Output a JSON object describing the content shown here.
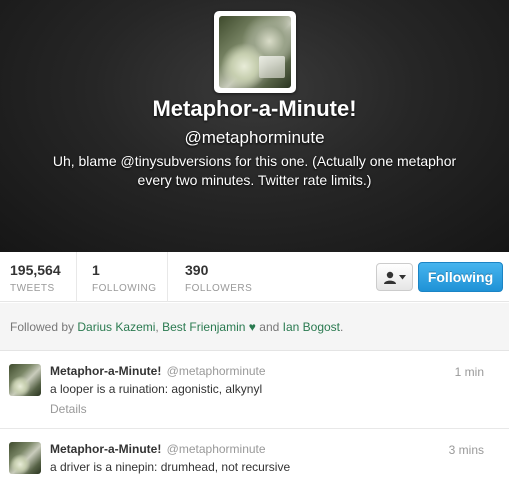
{
  "profile": {
    "name": "Metaphor-a-Minute!",
    "handle": "@metaphorminute",
    "bio": "Uh, blame @tinysubversions for this one. (Actually one metaphor every two minutes. Twitter rate limits.)"
  },
  "stats": {
    "tweets": {
      "value": "195,564",
      "label": "TWEETS"
    },
    "following": {
      "value": "1",
      "label": "FOLLOWING"
    },
    "followers": {
      "value": "390",
      "label": "FOLLOWERS"
    }
  },
  "actions": {
    "user_menu_icon": "person-icon",
    "following_label": "Following"
  },
  "followed_by": {
    "prefix": "Followed by",
    "user1": "Darius Kazemi",
    "user2": "Best Frienjamin",
    "heart": "♥",
    "conjunction": "and",
    "user3": "Ian Bogost",
    "suffix": "."
  },
  "tweets": [
    {
      "name": "Metaphor-a-Minute!",
      "handle": "@metaphorminute",
      "time": "1 min",
      "text": "a looper is a ruination: agonistic, alkynyl",
      "details": "Details"
    },
    {
      "name": "Metaphor-a-Minute!",
      "handle": "@metaphorminute",
      "time": "3 mins",
      "text": "a driver is a ninepin: drumhead, not recursive"
    }
  ],
  "colors": {
    "accent": "#1f92d6",
    "link_green": "#2a7a50",
    "hero_bg": "#262626"
  }
}
